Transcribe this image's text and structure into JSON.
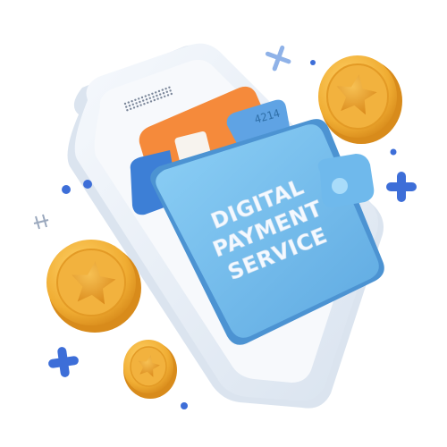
{
  "illustration": {
    "wallet_label": [
      "DIGITAL",
      "PAYMENT",
      "SERVICE"
    ],
    "card_number_fragment": "4214"
  },
  "icons": [
    "smartphone-icon",
    "wallet-icon",
    "credit-card-icon",
    "coin-star-icon",
    "plus-sparkle-icon",
    "dot-icon"
  ],
  "colors": {
    "phone_body": "#e9eff7",
    "phone_screen": "#f7f9fc",
    "wallet_blue": "#7ec4f0",
    "wallet_shadow": "#5aa5dd",
    "card_orange": "#f58a3b",
    "card_blue": "#5fa3e4",
    "coin_gold": "#f0b23a",
    "coin_dark": "#d98e1c",
    "sparkle_blue": "#3d6ed8"
  }
}
